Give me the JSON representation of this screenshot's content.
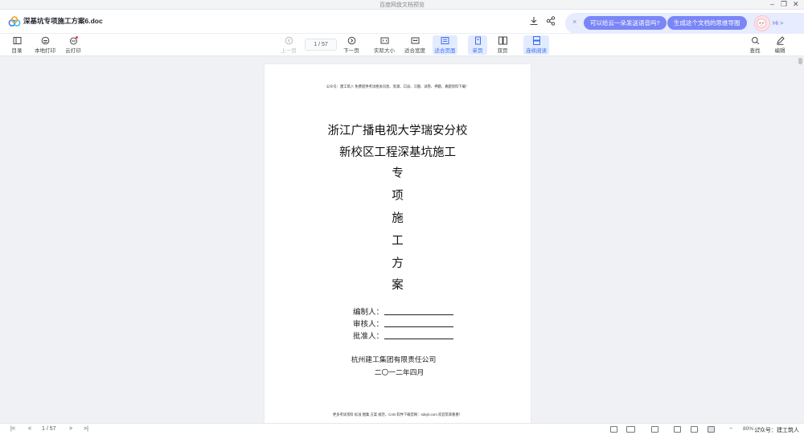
{
  "window": {
    "title": "百度网盘文档预览",
    "minimize": "–",
    "restore": "❐",
    "close": "✕"
  },
  "header": {
    "doc_title": "深基坑专项施工方案6.doc",
    "ai": {
      "close": "×",
      "question": "可以给云一朵发送语音吗?",
      "mindmap": "生成这个文档的思维导图",
      "hi": "Hi >"
    }
  },
  "toolbar": {
    "toc": "目录",
    "local_print": "本地打印",
    "cloud_print": "云打印",
    "prev_page": "上一页",
    "page_indicator": "1 / 57",
    "next_page": "下一页",
    "actual_size": "实际大小",
    "fit_width": "适合宽度",
    "fit_page": "适合页面",
    "single_page": "单页",
    "double_page": "双页",
    "continuous": "连续阅读",
    "search": "查找",
    "edit": "编辑"
  },
  "document": {
    "top_note": "公众号：建工筑人  免费提供考试相关讯息、资源、口诀、习题、试卷、押题、真题资料下载！",
    "title_line1": "浙江广播电视大学瑞安分校",
    "title_line2": "新校区工程深基坑施工",
    "vertical_chars": [
      "专",
      "项",
      "施",
      "工",
      "方",
      "案"
    ],
    "compiler": "编制人：",
    "reviewer": "审核人：",
    "approver": "批准人：",
    "company": "杭州建工集团有限责任公司",
    "date": "二〇一二年四月",
    "footer": "更多考试资料  标准  图集  方案  规范、CAD 软件下载官网：sdxyk.com  欢迎常来看看！"
  },
  "statusbar": {
    "first": "|<",
    "prev": "<",
    "page": "1 / 57",
    "next": ">",
    "last": ">|",
    "zoom_out": "−",
    "zoom": "80%",
    "zoom_in": "+",
    "watermark": "公众号：建工筑人"
  },
  "colors": {
    "accent": "#3a6df0",
    "ai_pill": "#7a86f7",
    "ai_bar": "#e7ecff",
    "badge": "#ff3b4a"
  }
}
